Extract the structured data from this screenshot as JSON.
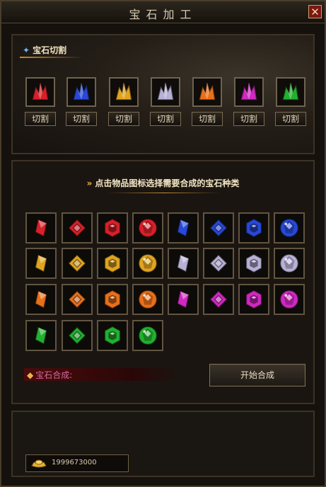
{
  "window": {
    "title": "宝石加工",
    "close_label": "✕"
  },
  "cut_panel": {
    "title": "宝石切割",
    "items": [
      {
        "gem": "red",
        "color": "#d8202a",
        "label": "切割"
      },
      {
        "gem": "blue",
        "color": "#2848d8",
        "label": "切割"
      },
      {
        "gem": "yellow",
        "color": "#e0a420",
        "label": "切割"
      },
      {
        "gem": "white",
        "color": "#b8b0d6",
        "label": "切割"
      },
      {
        "gem": "orange",
        "color": "#e8701a",
        "label": "切割"
      },
      {
        "gem": "purple",
        "color": "#d028c0",
        "label": "切割"
      },
      {
        "gem": "green",
        "color": "#22b030",
        "label": "切割"
      }
    ]
  },
  "synth_panel": {
    "hint": "点击物品图标选择需要合成的宝石种类",
    "gem_rows": [
      {
        "color": "#d8202a",
        "levels": 4
      },
      {
        "color": "#2848d8",
        "levels": 4
      },
      {
        "color": "#e0a420",
        "levels": 4
      },
      {
        "color": "#b8b0d6",
        "levels": 4
      },
      {
        "color": "#e8701a",
        "levels": 4
      },
      {
        "color": "#d028c0",
        "levels": 4
      },
      {
        "color": "#22b030",
        "levels": 4
      }
    ],
    "result_label": "宝石合成:",
    "start_button": "开始合成"
  },
  "currency": {
    "value": "1999673000",
    "icon": "gold-ingot-icon"
  }
}
